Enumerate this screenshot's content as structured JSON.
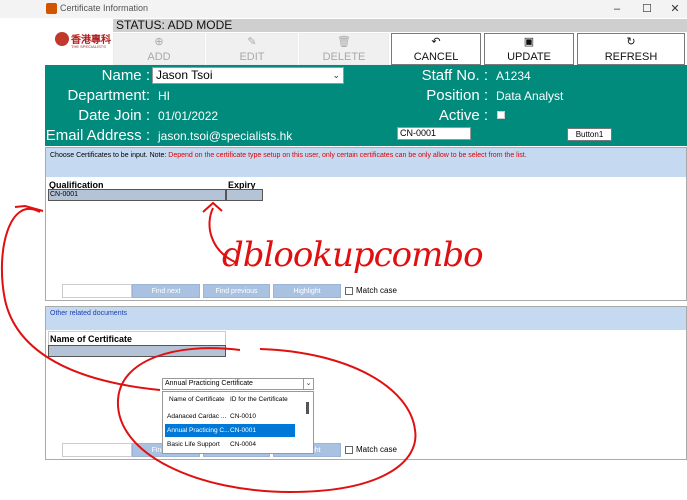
{
  "window": {
    "title": "Certificate Information",
    "minimize": "–",
    "maximize": "☐",
    "close": "✕"
  },
  "logo": {
    "cn": "香港專科",
    "en": "THE SPECIALISTS"
  },
  "status": "STATUS: ADD MODE",
  "toolbar": {
    "add": {
      "label": "ADD",
      "icon": "plus-icon"
    },
    "edit": {
      "label": "EDIT",
      "icon": "edit-icon"
    },
    "delete": {
      "label": "DELETE",
      "icon": "trash-icon"
    },
    "cancel": {
      "label": "CANCEL",
      "icon": "undo-icon"
    },
    "update": {
      "label": "UPDATE",
      "icon": "save-icon"
    },
    "refresh": {
      "label": "REFRESH",
      "icon": "refresh-icon"
    }
  },
  "form": {
    "name_label": "Name :",
    "name_value": "Jason Tsoi",
    "dept_label": "Department:",
    "dept_value": "HI",
    "date_label": "Date Join :",
    "date_value": "01/01/2022",
    "email_label": "Email Address :",
    "email_value": "jason.tsoi@specialists.hk",
    "staff_label": "Staff No. :",
    "staff_value": "A1234",
    "position_label": "Position :",
    "position_value": "Data Analyst",
    "active_label": "Active :",
    "cert_input": "CN-0001",
    "button1": "Button1"
  },
  "panel1": {
    "note_prefix": "Choose Certificates to be input. Note:",
    "note_red": "Depend on the certificate type setup on this user, only certain certificates can be only allow to be select from the list.",
    "col_qualification": "Qualification",
    "col_expiry": "Expiry",
    "row_value": "CN-0001",
    "find_next": "Find next",
    "find_previous": "Find previous",
    "highlight": "Highlight",
    "match_case": "Match case"
  },
  "panel2": {
    "header": "Other related documents",
    "col_name": "Name of Certificate",
    "find_next": "Find next",
    "find_previous": "Find previous",
    "highlight": "Highlight",
    "match_case": "Match case"
  },
  "dropdown": {
    "selected": "Annual Practicing Certificate",
    "col_name": "Name of Certificate",
    "col_id": "ID for the Certificate",
    "rows": [
      {
        "name": "Adanaced Cardac ...",
        "id": "CN-0010"
      },
      {
        "name": "Annual Practicing C...",
        "id": "CN-0001"
      },
      {
        "name": "Basic Life Support",
        "id": "CN-0004"
      }
    ]
  },
  "annotation": {
    "text": "dblookupcombo",
    "color": "#e01010"
  },
  "colors": {
    "teal": "#008b7c",
    "panel_header": "#c5d9f1",
    "selection": "#0078d7"
  }
}
